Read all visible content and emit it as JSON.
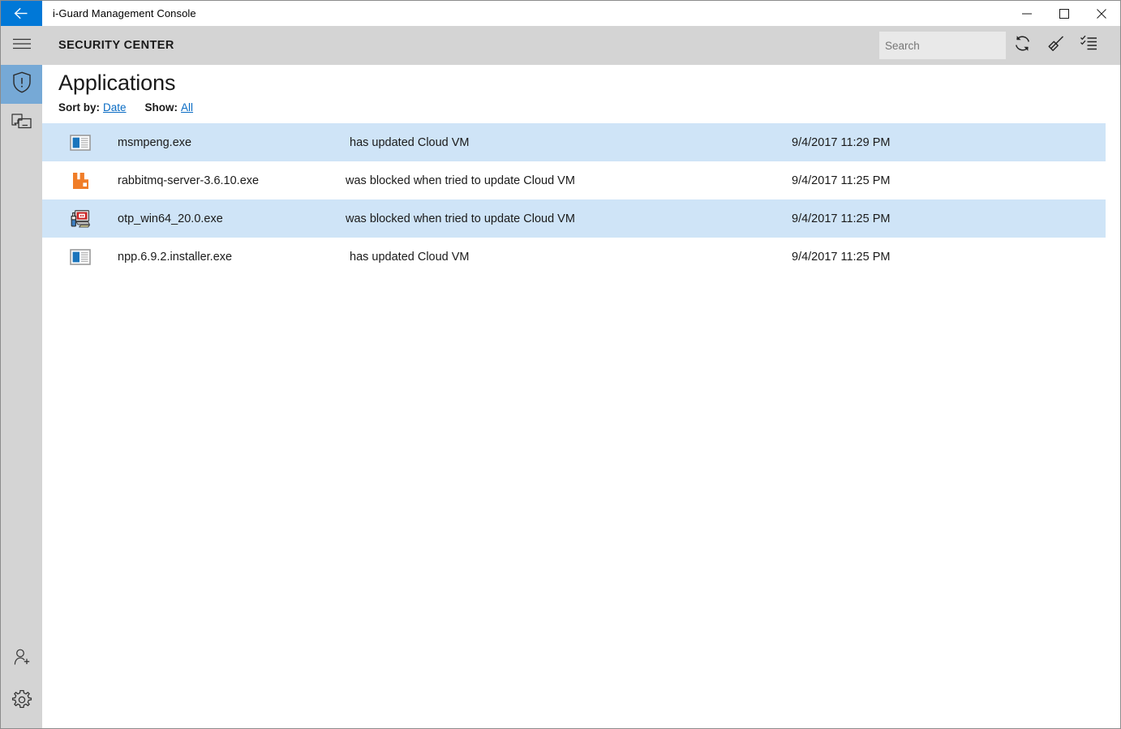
{
  "window": {
    "title": "i-Guard Management Console",
    "back_icon": "back-arrow-icon",
    "minimize_label": "─",
    "maximize_label": "□",
    "close_label": "✕"
  },
  "header": {
    "title": "SECURITY CENTER",
    "search": {
      "placeholder": "Search",
      "value": ""
    },
    "tools": [
      {
        "name": "refresh-icon",
        "label": "Refresh"
      },
      {
        "name": "clear-icon",
        "label": "Clear"
      },
      {
        "name": "checklist-icon",
        "label": "Select items"
      }
    ]
  },
  "rail": {
    "items": [
      {
        "name": "hamburger-menu-icon",
        "label": "Menu",
        "selected": false
      },
      {
        "name": "shield-alert-icon",
        "label": "Security Center",
        "selected": true
      },
      {
        "name": "devices-icon",
        "label": "Devices",
        "selected": false
      }
    ],
    "bottom_items": [
      {
        "name": "add-user-icon",
        "label": "Add user"
      },
      {
        "name": "settings-gear-icon",
        "label": "Settings"
      }
    ]
  },
  "main": {
    "page_title": "Applications",
    "filters": {
      "sort_label": "Sort by:",
      "sort_value": "Date",
      "show_label": "Show:",
      "show_value": "All"
    },
    "rows": [
      {
        "icon": "file-window-blue-icon",
        "name": "msmpeng.exe",
        "action": "has updated Cloud VM",
        "date": "9/4/2017 11:29 PM",
        "selected": true
      },
      {
        "icon": "rabbitmq-icon",
        "name": "rabbitmq-server-3.6.10.exe",
        "action": "was blocked when tried to update Cloud VM",
        "date": "9/4/2017 11:25 PM",
        "selected": false
      },
      {
        "icon": "otp-installer-icon",
        "name": "otp_win64_20.0.exe",
        "action": "was blocked when tried to update Cloud VM",
        "date": "9/4/2017 11:25 PM",
        "selected": true
      },
      {
        "icon": "file-window-blue-icon",
        "name": "npp.6.9.2.installer.exe",
        "action": "has updated Cloud VM",
        "date": "9/4/2017 11:25 PM",
        "selected": false
      }
    ]
  },
  "colors": {
    "accent": "#0078d7",
    "row_selected": "#cfe4f7",
    "rail_selected": "#76a9d6",
    "chrome": "#d4d4d4",
    "link": "#0a6cc4",
    "rabbitmq_orange": "#f07d28"
  }
}
